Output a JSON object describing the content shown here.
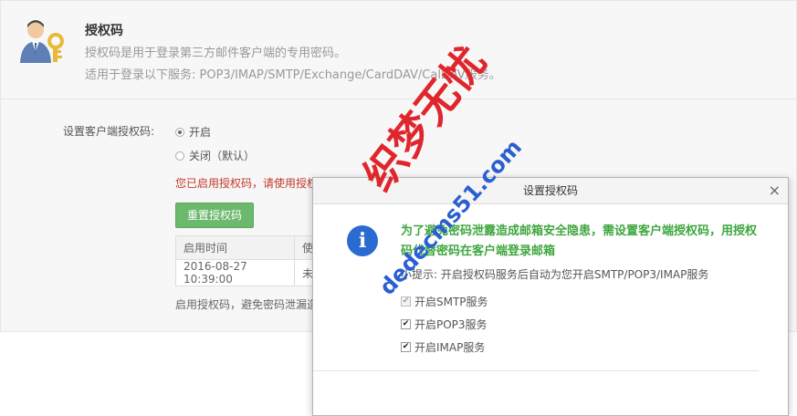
{
  "header": {
    "title": "授权码",
    "line1": "授权码是用于登录第三方邮件客户端的专用密码。",
    "line2": "适用于登录以下服务: POP3/IMAP/SMTP/Exchange/CardDAV/CalDAV服务。"
  },
  "settings": {
    "label": "设置客户端授权码:",
    "option_on": "开启",
    "option_off": "关闭（默认）",
    "selected": "开启",
    "notice": "您已启用授权码，请使用授权",
    "reset_button": "重置授权码",
    "table": {
      "headers": [
        "启用时间",
        "使"
      ],
      "rows": [
        [
          "2016-08-27 10:39:00",
          "未"
        ]
      ]
    },
    "footer": "启用授权码，避免密码泄漏造"
  },
  "dialog": {
    "title": "设置授权码",
    "close_glyph": "×",
    "warning": "为了避免密码泄露造成邮箱安全隐患，需设置客户端授权码，用授权码代替密码在客户端登录邮箱",
    "tip": "小提示: 开启授权码服务后自动为您开启SMTP/POP3/IMAP服务",
    "checkboxes": [
      {
        "label": "开启SMTP服务",
        "checked": true,
        "disabled": true
      },
      {
        "label": "开启POP3服务",
        "checked": true,
        "disabled": false
      },
      {
        "label": "开启IMAP服务",
        "checked": true,
        "disabled": false
      }
    ]
  },
  "watermark": {
    "main": "织梦无忧",
    "url": "dedecms51.com"
  },
  "colors": {
    "accent_green": "#6cb86c",
    "warning_green": "#3fa63f",
    "notice_red": "#c0392b",
    "info_blue": "#2a6bd1"
  },
  "icons": {
    "avatar": "user-key-icon",
    "info": "info-icon",
    "close": "close-icon",
    "check": "checkmark-icon"
  }
}
